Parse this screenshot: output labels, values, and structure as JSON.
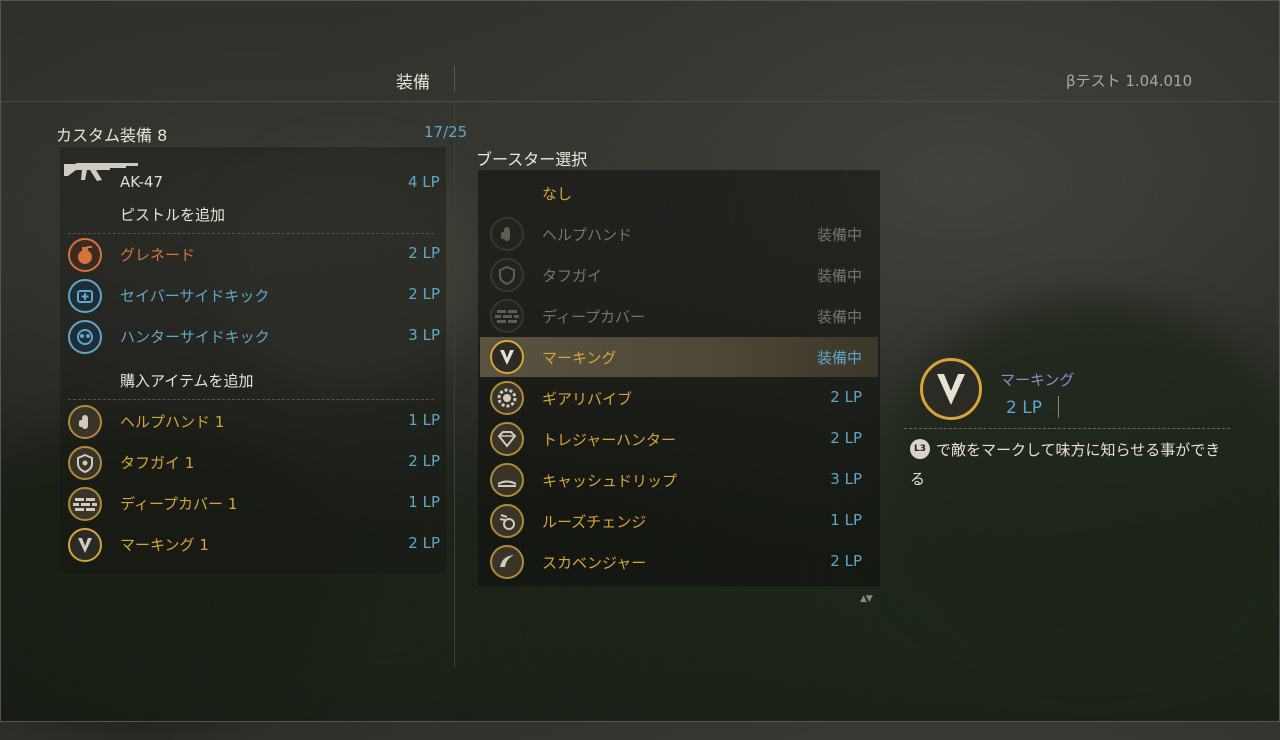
{
  "header": {
    "title": "装備",
    "version": "βテスト 1.04.010"
  },
  "loadout": {
    "title": "カスタム装備 8",
    "count": "17/25",
    "weapon": {
      "icon": "ak47-rifle-icon",
      "name": "AK-47",
      "lp": "4 LP"
    },
    "add_pistol": "ピストルを追加",
    "items": [
      {
        "name": "グレネード",
        "lp": "2 LP",
        "icon": "grenade-icon"
      },
      {
        "name": "セイバーサイドキック",
        "lp": "2 LP",
        "icon": "medkit-sidekick-icon"
      },
      {
        "name": "ハンターサイドキック",
        "lp": "3 LP",
        "icon": "hunter-sidekick-icon"
      }
    ],
    "add_purchase": "購入アイテムを追加",
    "boosters": [
      {
        "name": "ヘルプハンド 1",
        "lp": "1 LP",
        "icon": "help-hand-icon"
      },
      {
        "name": "タフガイ 1",
        "lp": "2 LP",
        "icon": "tough-guy-shield-icon"
      },
      {
        "name": "ディープカバー 1",
        "lp": "1 LP",
        "icon": "deep-cover-brick-icon"
      },
      {
        "name": "マーキング 1",
        "lp": "2 LP",
        "icon": "marking-v-icon"
      }
    ]
  },
  "booster_select": {
    "title": "ブースター選択",
    "none_label": "なし",
    "rows": [
      {
        "name": "ヘルプハンド",
        "status": "装備中",
        "icon": "help-hand-icon"
      },
      {
        "name": "タフガイ",
        "status": "装備中",
        "icon": "tough-guy-shield-icon"
      },
      {
        "name": "ディープカバー",
        "status": "装備中",
        "icon": "deep-cover-brick-icon"
      },
      {
        "name": "マーキング",
        "status": "装備中",
        "icon": "marking-v-icon"
      },
      {
        "name": "ギアリバイブ",
        "status": "2 LP",
        "icon": "gear-revive-icon"
      },
      {
        "name": "トレジャーハンター",
        "status": "2 LP",
        "icon": "treasure-diamond-icon"
      },
      {
        "name": "キャッシュドリップ",
        "status": "3 LP",
        "icon": "cash-drip-icon"
      },
      {
        "name": "ルーズチェンジ",
        "status": "1 LP",
        "icon": "loose-change-coin-icon"
      },
      {
        "name": "スカベンジャー",
        "status": "2 LP",
        "icon": "scavenger-claw-icon"
      }
    ],
    "scroll_icon": "scroll-arrows-icon"
  },
  "detail": {
    "name": "マーキング",
    "lp": "2 LP",
    "button_glyph": "L3",
    "description": "で敵をマークして味方に知らせる事ができる"
  },
  "colors": {
    "accent_blue": "#5fa7c8",
    "gold": "#d8a33a",
    "orange": "#d3743a",
    "selected_row": "#5a5340"
  }
}
